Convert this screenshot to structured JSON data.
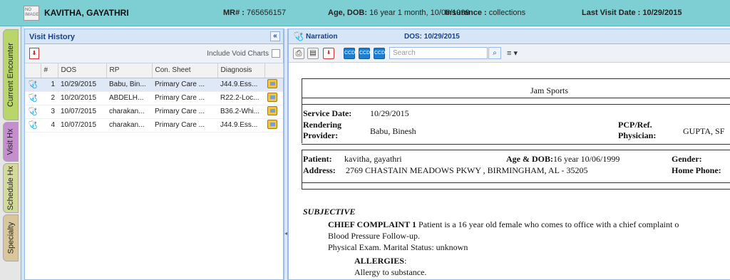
{
  "header": {
    "no_image": "NO IMAGE",
    "patient_name": "KAVITHA, GAYATHRI",
    "mr_label": "MR# :",
    "mr_value": "765656157",
    "age_label": "Age, DOB:",
    "age_value": "16 year 1 month, 10/06/1999",
    "insurance_label": "Insurance :",
    "insurance_value": "collections",
    "last_visit_label": "Last Visit Date :",
    "last_visit_value": "10/29/2015"
  },
  "side_tabs": [
    "Current Encounter",
    "Visit Hx",
    "Schedule Hx",
    "Specialty"
  ],
  "visit_history": {
    "title": "Visit History",
    "collapse": "«",
    "include_void": "Include Void Charts",
    "columns": [
      "#",
      "DOS",
      "RP",
      "Con. Sheet",
      "Diagnosis"
    ],
    "rows": [
      {
        "num": "1",
        "dos": "10/29/2015",
        "rp": "Babu, Bin...",
        "sheet": "Primary Care ...",
        "diag": "J44.9.Ess..."
      },
      {
        "num": "2",
        "dos": "10/20/2015",
        "rp": "ABDELH...",
        "sheet": "Primary Care ...",
        "diag": "R22.2-Loc..."
      },
      {
        "num": "3",
        "dos": "10/07/2015",
        "rp": "charakan...",
        "sheet": "Primary Care ...",
        "diag": "B36.2-Whi..."
      },
      {
        "num": "4",
        "dos": "10/07/2015",
        "rp": "charakan...",
        "sheet": "Primary Care ...",
        "diag": "J44.9.Ess..."
      }
    ]
  },
  "narration": {
    "title": "Narration",
    "dos": "DOS: 10/29/2015",
    "search_placeholder": "Search",
    "ccd_labels": [
      "CCD",
      "CCDA",
      "CCDA"
    ]
  },
  "document": {
    "practice": "Jam Sports",
    "service_date_label": "Service Date:",
    "service_date": "10/29/2015",
    "rendering_label_1": "Rendering",
    "rendering_label_2": "Provider:",
    "rendering_value": "Babu, Binesh",
    "pcp_label_1": "PCP/Ref.",
    "pcp_label_2": "Physician:",
    "pcp_value": "GUPTA, SF",
    "patient_label": "Patient:",
    "patient_value": "kavitha, gayathri",
    "agedob_label": "Age & DOB:",
    "agedob_value": "16 year  10/06/1999",
    "gender_label": "Gender:",
    "address_label": "Address:",
    "address_value": "2769 CHASTAIN MEADOWS PKWY , BIRMINGHAM, AL - 35205",
    "homephone_label": "Home Phone:",
    "subjective": "SUBJECTIVE",
    "cc_label": "CHIEF COMPLAINT 1",
    "cc_text": "Patient is a 16 year old female who comes to office with a chief complaint o",
    "cc_line2": "Blood Pressure Follow-up.",
    "cc_line3": "Physical Exam. Marital Status: unknown",
    "allergies_label": "ALLERGIES",
    "allergies_colon": ":",
    "allergy_text": "Allergy to substance."
  }
}
